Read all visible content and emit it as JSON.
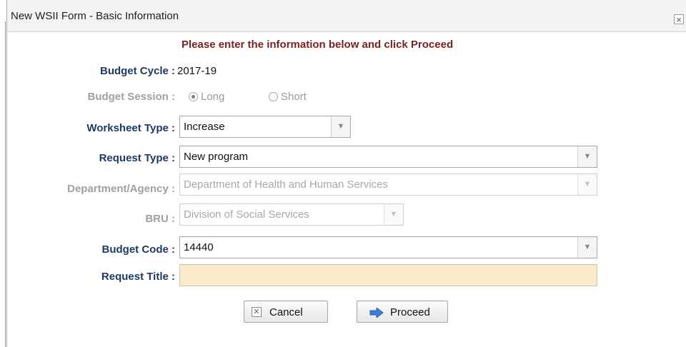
{
  "dialog": {
    "title": "New WSII Form - Basic Information",
    "close_glyph": "×"
  },
  "instruction": "Please enter the information below and click Proceed",
  "fields": {
    "budget_cycle": {
      "label": "Budget Cycle :",
      "value": "2017-19"
    },
    "budget_session": {
      "label": "Budget Session :",
      "options": [
        "Long",
        "Short"
      ],
      "selected": "Long",
      "disabled": true
    },
    "worksheet_type": {
      "label": "Worksheet Type :",
      "value": "Increase"
    },
    "request_type": {
      "label": "Request Type :",
      "value": "New program"
    },
    "department_agency": {
      "label": "Department/Agency :",
      "value": "Department of Health and Human Services",
      "disabled": true
    },
    "bru": {
      "label": "BRU :",
      "value": "Division of Social Services",
      "disabled": true
    },
    "budget_code": {
      "label": "Budget Code :",
      "value": "14440"
    },
    "request_title": {
      "label": "Request Title :",
      "value": ""
    }
  },
  "buttons": {
    "cancel": {
      "label": "Cancel",
      "icon": "x-box-icon"
    },
    "proceed": {
      "label": "Proceed",
      "icon": "right-arrow-icon"
    }
  },
  "colors": {
    "label": "#1f3a66",
    "instruction": "#7b1f1f",
    "title_input_bg": "#faebc8",
    "proceed_arrow": "#3a7fd5"
  }
}
